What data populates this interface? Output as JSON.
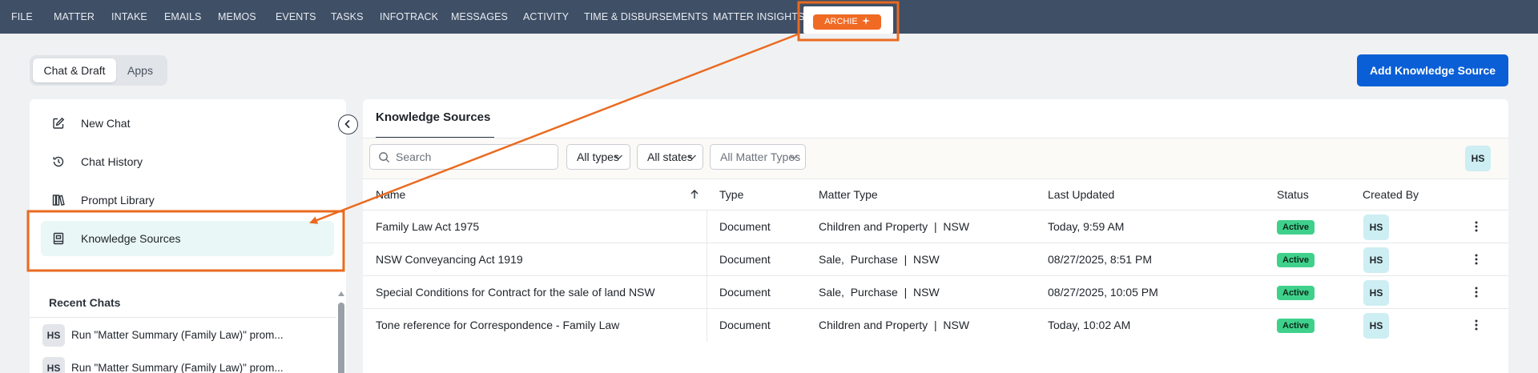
{
  "topnav": {
    "items": [
      "FILE",
      "MATTER",
      "INTAKE",
      "EMAILS",
      "MEMOS",
      "EVENTS",
      "TASKS",
      "INFOTRACK",
      "MESSAGES",
      "ACTIVITY",
      "TIME & DISBURSEMENTS",
      "MATTER INSIGHTS"
    ],
    "active_tab": "ARCHIE",
    "active_tab_icon": "sparkle-icon"
  },
  "header": {
    "segments": [
      "Chat & Draft",
      "Apps"
    ],
    "add_button": "Add Knowledge Source"
  },
  "sidebar": {
    "items": [
      {
        "label": "New Chat",
        "icon": "edit-icon"
      },
      {
        "label": "Chat History",
        "icon": "history-icon"
      },
      {
        "label": "Prompt Library",
        "icon": "library-icon"
      },
      {
        "label": "Knowledge Sources",
        "icon": "knowledge-book-icon",
        "active": true
      }
    ],
    "recent_title": "Recent Chats",
    "recent": [
      {
        "initials": "HS",
        "text": "Run \"Matter Summary (Family Law)\" prom..."
      },
      {
        "initials": "HS",
        "text": "Run \"Matter Summary (Family Law)\" prom..."
      }
    ]
  },
  "main": {
    "tab": "Knowledge Sources",
    "search_placeholder": "Search",
    "filters": [
      "All types",
      "All states",
      "All Matter Types"
    ],
    "user_initials": "HS",
    "columns": [
      "Name",
      "Type",
      "Matter Type",
      "Last Updated",
      "Status",
      "Created By"
    ],
    "rows": [
      {
        "name": "Family Law Act 1975",
        "type": "Document",
        "matter_type": "Children and Property  |  NSW",
        "updated": "Today, 9:59 AM",
        "status": "Active",
        "created_by": "HS"
      },
      {
        "name": "NSW Conveyancing Act 1919",
        "type": "Document",
        "matter_type": "Sale,  Purchase  |  NSW",
        "updated": "08/27/2025, 8:51 PM",
        "status": "Active",
        "created_by": "HS"
      },
      {
        "name": "Special Conditions for Contract for the sale of land NSW",
        "type": "Document",
        "matter_type": "Sale,  Purchase  |  NSW",
        "updated": "08/27/2025, 10:05 PM",
        "status": "Active",
        "created_by": "HS"
      },
      {
        "name": "Tone reference for Correspondence - Family Law",
        "type": "Document",
        "matter_type": "Children and Property  |  NSW",
        "updated": "Today, 10:02 AM",
        "status": "Active",
        "created_by": "HS"
      }
    ]
  },
  "colors": {
    "nav_bg": "#3f4f66",
    "archie_orange": "#f06a24",
    "primary_blue": "#0a5fd6",
    "active_green": "#3fd18c",
    "avatar_bg": "#cdeef2",
    "annotation_orange": "#ea6a1f"
  }
}
